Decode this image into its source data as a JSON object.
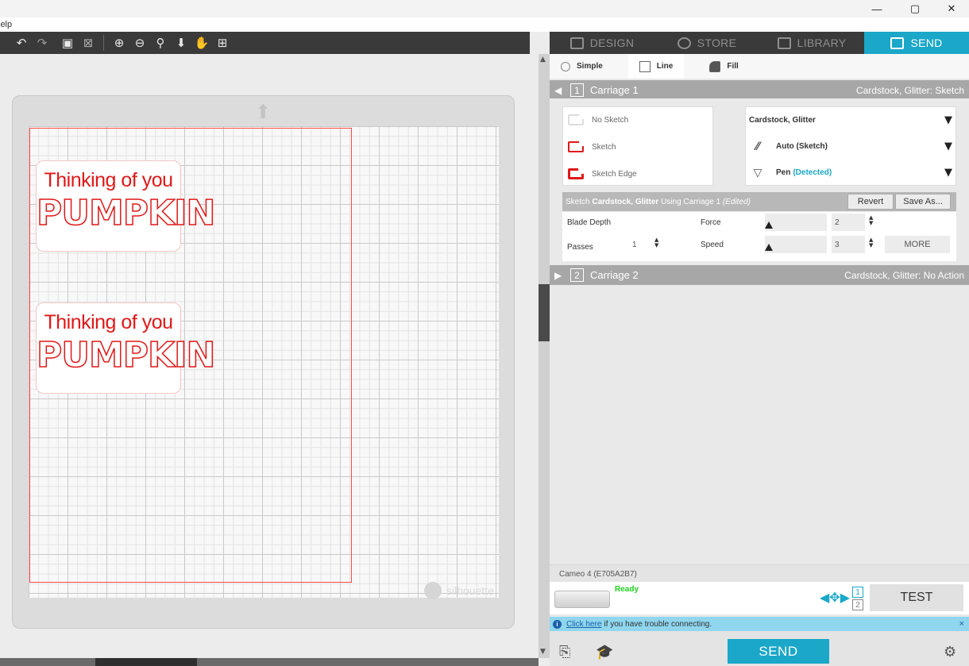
{
  "menubar": {
    "partial_label": "lelp"
  },
  "window": {
    "minimize": "—",
    "restore": "▢",
    "close": "✕"
  },
  "toolbar": {
    "icons": [
      "undo-icon",
      "redo-icon",
      "group-icon",
      "ungroup-icon",
      "zoom-in-icon",
      "zoom-out-icon",
      "zoom-selection-icon",
      "move-down-icon",
      "pan-hand-icon",
      "fit-page-icon"
    ]
  },
  "nav": {
    "tabs": [
      {
        "label": "DESIGN",
        "icon": "design-grid-icon"
      },
      {
        "label": "STORE",
        "icon": "store-icon"
      },
      {
        "label": "LIBRARY",
        "icon": "library-icon"
      },
      {
        "label": "SEND",
        "icon": "send-machine-icon",
        "active": true
      }
    ]
  },
  "canvas": {
    "labels": [
      {
        "line1": "Thinking of you",
        "line2": "PUMPKIN"
      },
      {
        "line1": "Thinking of you",
        "line2": "PUMPKIN"
      }
    ],
    "brand": "silhouette"
  },
  "modes": {
    "simple": "Simple",
    "line": "Line",
    "fill": "Fill"
  },
  "carriage1": {
    "number": "1",
    "title": "Carriage 1",
    "summary": "Cardstock, Glitter: Sketch",
    "sketch_options": [
      "No Sketch",
      "Sketch",
      "Sketch Edge"
    ],
    "material": "Cardstock, Glitter",
    "action": "Auto (Sketch)",
    "tool": "Pen",
    "tool_status": "(Detected)",
    "settings_prefix": "Sketch",
    "settings_material": "Cardstock, Glitter",
    "settings_middle": "Using Carriage 1",
    "settings_edited": "(Edited)",
    "revert": "Revert",
    "save_as": "Save As...",
    "blade_depth_label": "Blade Depth",
    "passes_label": "Passes",
    "passes_value": "1",
    "force_label": "Force",
    "force_value": "2",
    "speed_label": "Speed",
    "speed_value": "3",
    "more": "MORE"
  },
  "carriage2": {
    "number": "2",
    "title": "Carriage 2",
    "summary": "Cardstock, Glitter: No Action"
  },
  "device": {
    "name": "Cameo 4 (E705A2B7)",
    "status": "Ready",
    "carriage_selectors": [
      "1",
      "2"
    ],
    "test": "TEST"
  },
  "connection": {
    "link": "Click here",
    "text": "if you have trouble connecting.",
    "close": "×"
  },
  "send": "SEND",
  "colors": {
    "accent": "#1aa7c8",
    "cut_line": "#e01818",
    "ready": "#1fd11f"
  }
}
